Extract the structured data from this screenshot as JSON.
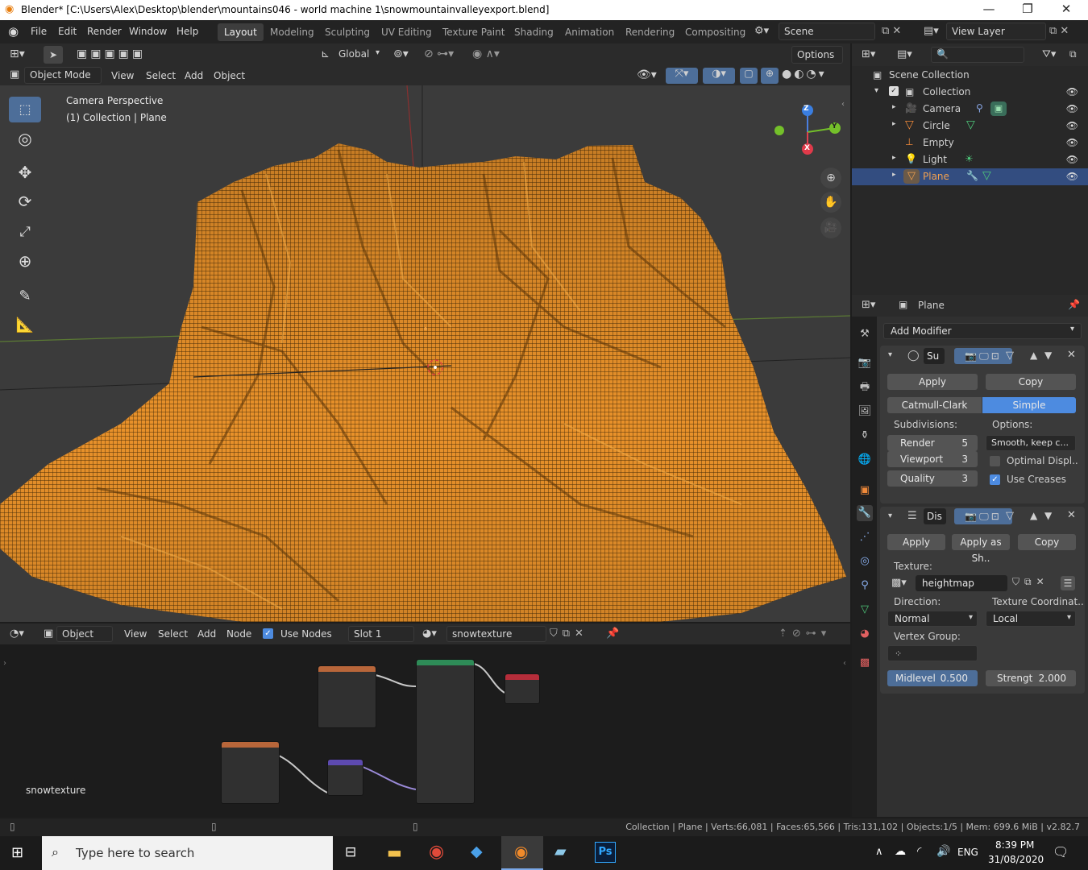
{
  "window": {
    "title": "Blender* [C:\\Users\\Alex\\Desktop\\blender\\mountains046 - world machine 1\\snowmountainvalleyexport.blend]"
  },
  "menu": [
    "File",
    "Edit",
    "Render",
    "Window",
    "Help"
  ],
  "workspaces": [
    "Layout",
    "Modeling",
    "Sculpting",
    "UV Editing",
    "Texture Paint",
    "Shading",
    "Animation",
    "Rendering",
    "Compositing"
  ],
  "scene": "Scene",
  "view_layer": "View Layer",
  "viewport": {
    "transform_orientation": "Global",
    "options_label": "Options",
    "mode": "Object Mode",
    "menu": [
      "View",
      "Select",
      "Add",
      "Object"
    ],
    "overlay_line1": "Camera Perspective",
    "overlay_line2": "(1) Collection | Plane",
    "gizmo": {
      "z": "Z",
      "y": "Y",
      "x": "X"
    }
  },
  "node_editor": {
    "type": "Object",
    "menu": [
      "View",
      "Select",
      "Add",
      "Node"
    ],
    "use_nodes": "Use Nodes",
    "slot": "Slot 1",
    "material": "snowtexture",
    "overlay_label": "snowtexture"
  },
  "outliner": {
    "root": "Scene Collection",
    "collection": "Collection",
    "items": [
      "Camera",
      "Circle",
      "Empty",
      "Light",
      "Plane"
    ],
    "selected": "Plane"
  },
  "properties": {
    "object_name": "Plane",
    "add_modifier": "Add Modifier",
    "subsurf": {
      "name": "Su",
      "apply": "Apply",
      "copy": "Copy",
      "catmull": "Catmull-Clark",
      "simple": "Simple",
      "subdivisions_label": "Subdivisions:",
      "options_label": "Options:",
      "render_label": "Render",
      "render_value": "5",
      "viewport_label": "Viewport",
      "viewport_value": "3",
      "quality_label": "Quality",
      "quality_value": "3",
      "smooth": "Smooth, keep c...",
      "optimal": "Optimal Displ..",
      "use_creases": "Use Creases"
    },
    "displace": {
      "name": "Dis",
      "apply": "Apply",
      "apply_shape": "Apply as Sh..",
      "copy": "Copy",
      "texture_label": "Texture:",
      "texture": "heightmap",
      "direction_label": "Direction:",
      "direction": "Normal",
      "coords_label": "Texture Coordinat..",
      "coords": "Local",
      "vertex_group_label": "Vertex Group:",
      "midlevel_label": "Midlevel",
      "midlevel_value": "0.500",
      "strength_label": "Strengt",
      "strength_value": "2.000"
    }
  },
  "status": {
    "text": "Collection | Plane | Verts:66,081 | Faces:65,566 | Tris:131,102 | Objects:1/5 | Mem: 699.6 MiB | v2.82.7"
  },
  "taskbar": {
    "search_placeholder": "Type here to search",
    "lang": "ENG",
    "time": "8:39 PM",
    "date": "31/08/2020"
  },
  "colors": {
    "accent": "#4d6e99",
    "wire": "#e8912a",
    "selected_row": "#334d80"
  }
}
